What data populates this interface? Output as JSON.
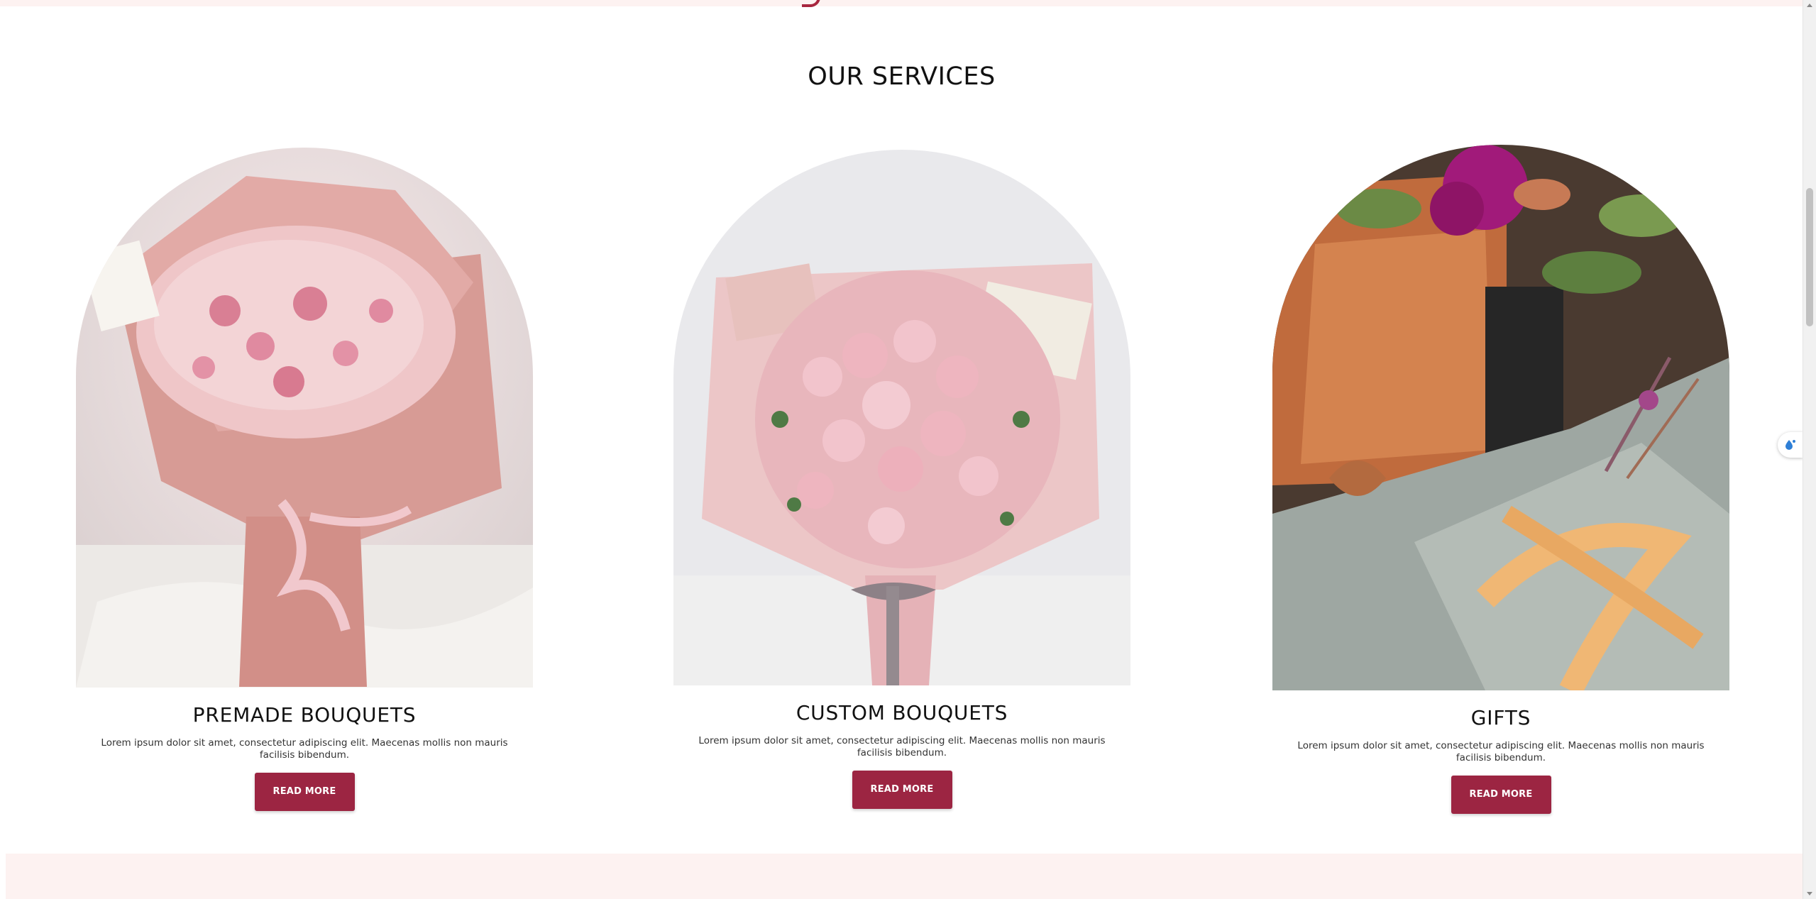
{
  "section": {
    "title": "OUR SERVICES"
  },
  "services": [
    {
      "title": "PREMADE BOUQUETS",
      "description": "Lorem ipsum dolor sit amet, consectetur adipiscing elit. Maecenas mollis non mauris facilisis bibendum.",
      "button_label": "READ MORE",
      "image": "pink-gypsophila-rose-bouquet"
    },
    {
      "title": "CUSTOM BOUQUETS",
      "description": "Lorem ipsum dolor sit amet, consectetur adipiscing elit. Maecenas mollis non mauris facilisis bibendum.",
      "button_label": "READ MORE",
      "image": "pink-rose-bouquet-with-ribbon"
    },
    {
      "title": "GIFTS",
      "description": "Lorem ipsum dolor sit amet, consectetur adipiscing elit. Maecenas mollis non mauris facilisis bibendum.",
      "button_label": "READ MORE",
      "image": "wrapped-gifts-with-flowers"
    }
  ],
  "colors": {
    "accent": "#9c2542",
    "band": "#fdf2f1",
    "text": "#111111"
  },
  "widget": {
    "icon": "water-drop-icon"
  }
}
